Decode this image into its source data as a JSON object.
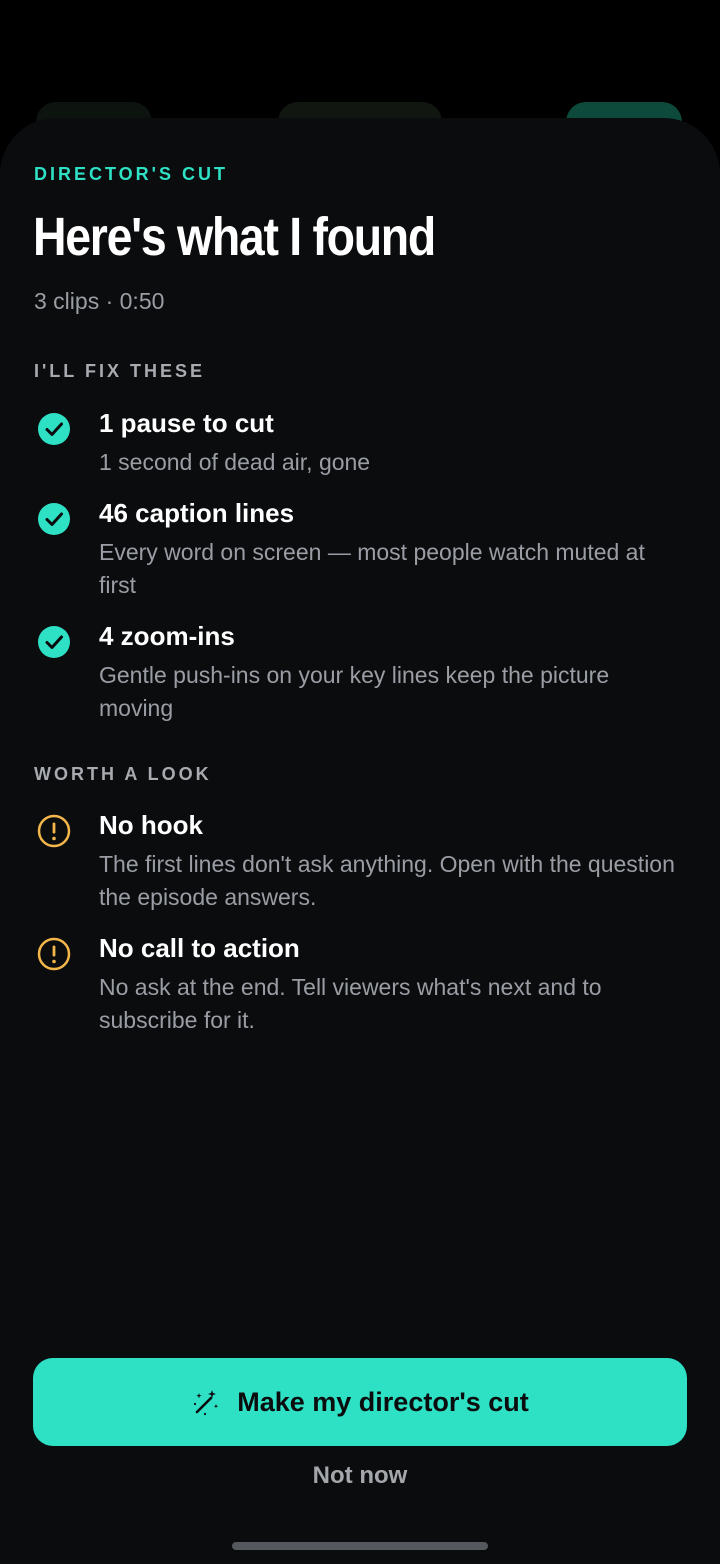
{
  "header": {
    "eyebrow": "DIRECTOR'S CUT",
    "title": "Here's what I found",
    "subtitle": "3 clips · 0:50"
  },
  "fix_section": {
    "label": "I'LL FIX THESE",
    "items": [
      {
        "icon": "check-circle-icon",
        "title": "1 pause to cut",
        "description": "1 second of dead air, gone"
      },
      {
        "icon": "check-circle-icon",
        "title": "46 caption lines",
        "description": "Every word on screen — most people watch muted at first"
      },
      {
        "icon": "check-circle-icon",
        "title": "4 zoom-ins",
        "description": "Gentle push-ins on your key lines keep the picture moving"
      }
    ]
  },
  "look_section": {
    "label": "WORTH A LOOK",
    "items": [
      {
        "icon": "warning-circle-icon",
        "title": "No hook",
        "description": "The first lines don't ask anything. Open with the question the episode answers."
      },
      {
        "icon": "warning-circle-icon",
        "title": "No call to action",
        "description": "No ask at the end. Tell viewers what's next and to subscribe for it."
      }
    ]
  },
  "actions": {
    "primary_label": "Make my director's cut",
    "primary_icon": "magic-wand-icon",
    "secondary_label": "Not now"
  },
  "colors": {
    "accent": "#2ee0c4",
    "warning": "#f2b64a",
    "sheet_background": "#0b0c0e",
    "muted_text": "#9a9ea4"
  }
}
